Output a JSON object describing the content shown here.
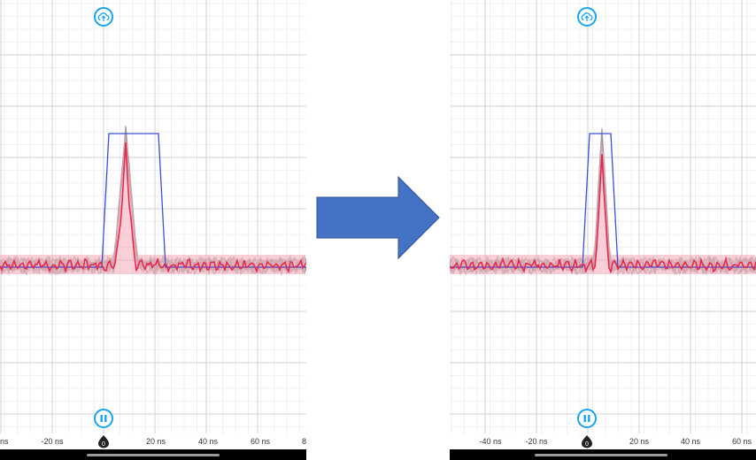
{
  "colors": {
    "accent": "#1aa3e8",
    "pulse": "#3f4ed6",
    "signal": "#e8274d",
    "signal_fill": "#f5a9b8",
    "noise": "#9c9c9c",
    "grid": "#e6e6e6",
    "arrow": "#4472c4"
  },
  "icons": {
    "upload": "cloud-upload-icon",
    "pause": "pause-icon",
    "zero": "zero-marker-icon",
    "arrow": "right-arrow-icon"
  },
  "panels": [
    {
      "id": "before",
      "ticks": [
        {
          "label": "ns"
        },
        {
          "label": "-20 ns"
        },
        {
          "label": "0"
        },
        {
          "label": "20 ns"
        },
        {
          "label": "40 ns"
        },
        {
          "label": "60 ns"
        },
        {
          "label": "8"
        }
      ]
    },
    {
      "id": "after",
      "ticks": [
        {
          "label": "-40 ns"
        },
        {
          "label": "-20 ns"
        },
        {
          "label": "0"
        },
        {
          "label": "20 ns"
        },
        {
          "label": "40 ns"
        },
        {
          "label": "60 ns"
        }
      ]
    }
  ]
}
